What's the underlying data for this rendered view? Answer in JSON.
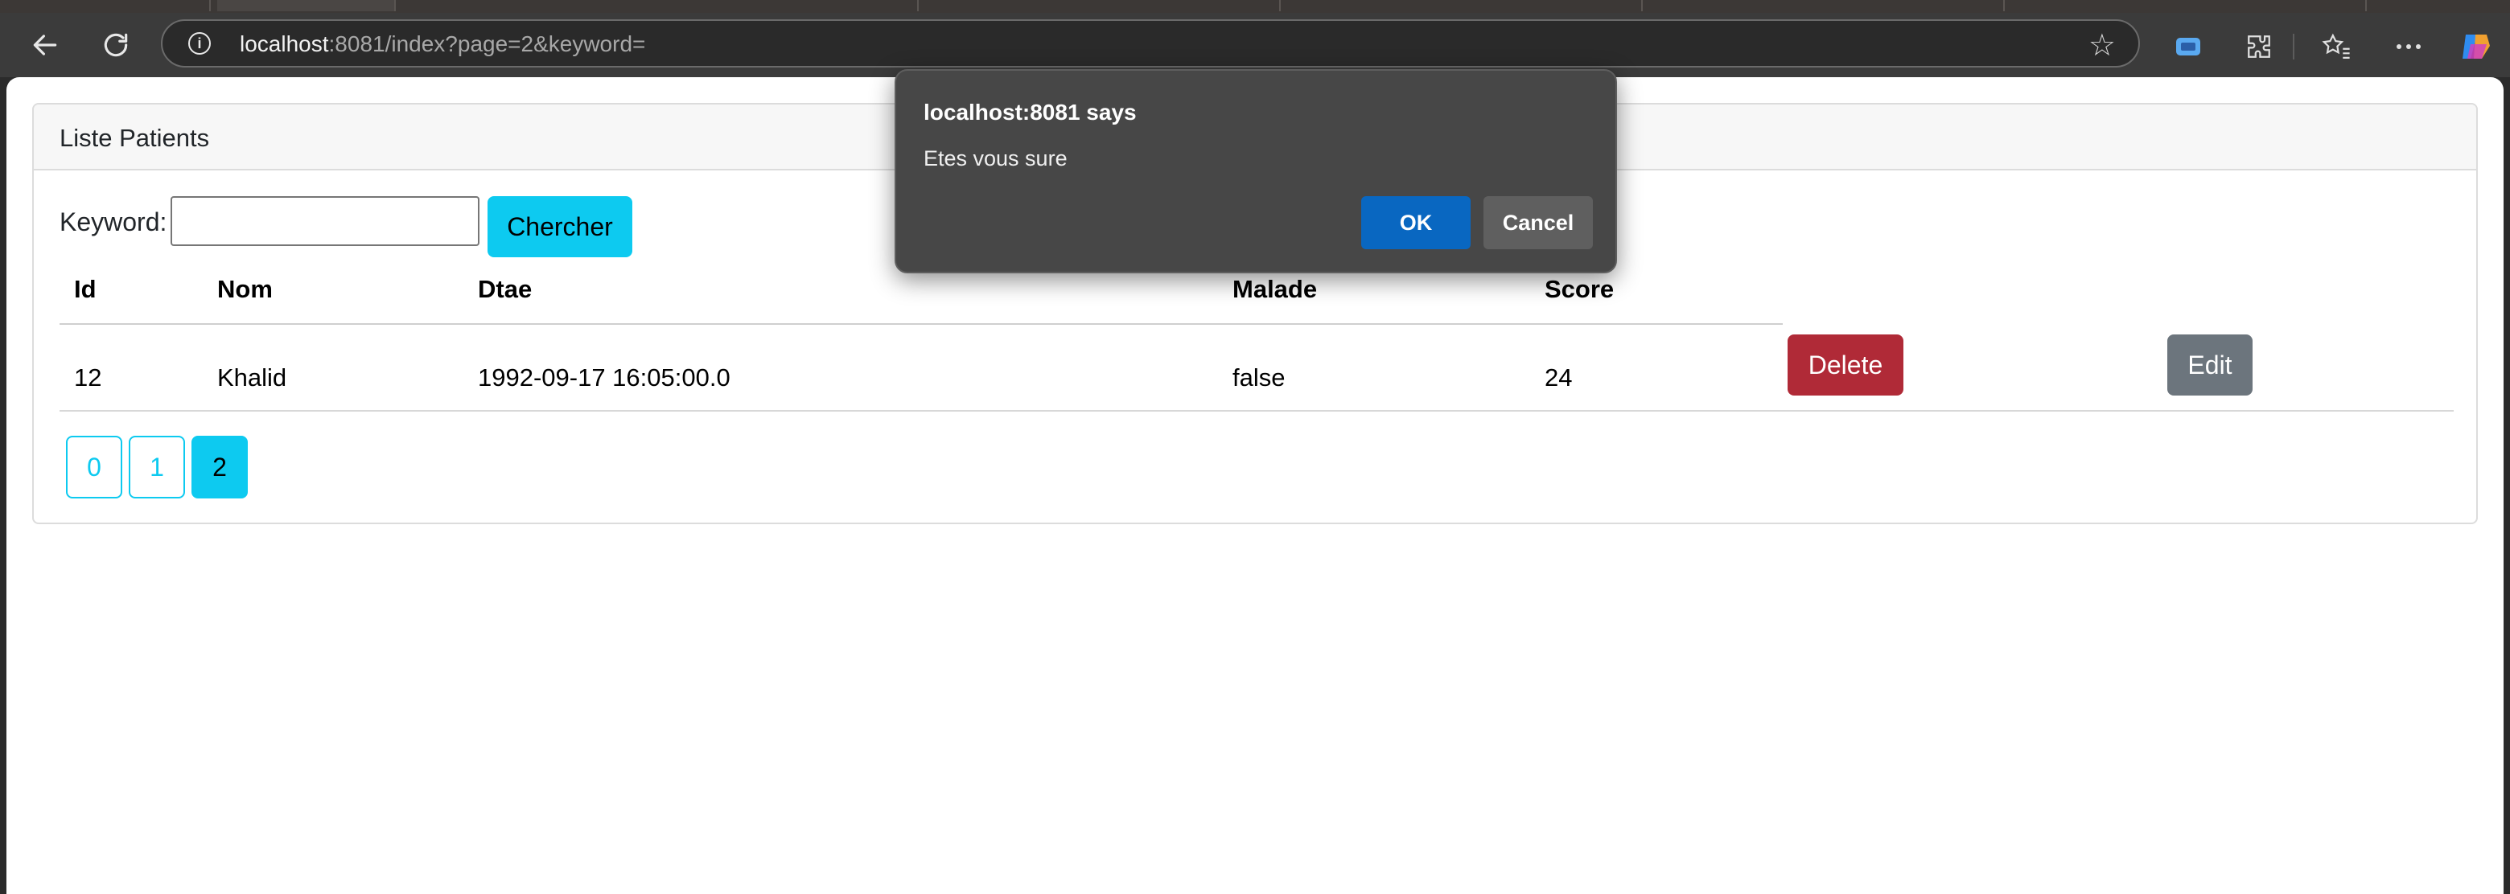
{
  "browser": {
    "url_host": "localhost",
    "url_rest": ":8081/index?page=2&keyword=",
    "icons": [
      "back-arrow-icon",
      "refresh-icon",
      "info-icon",
      "star-icon",
      "translate-icon",
      "extensions-icon",
      "favorites-icon",
      "more-icon",
      "copilot-icon"
    ]
  },
  "card": {
    "title": "Liste Patients"
  },
  "search": {
    "label": "Keyword:",
    "value": "",
    "button_label": "Chercher"
  },
  "table": {
    "headers": [
      "Id",
      "Nom",
      "Dtae",
      "Malade",
      "Score"
    ],
    "rows": [
      {
        "id": "12",
        "nom": "Khalid",
        "date": "1992-09-17 16:05:00.0",
        "malade": "false",
        "score": "24",
        "delete_label": "Delete",
        "edit_label": "Edit"
      }
    ]
  },
  "pagination": {
    "pages": [
      "0",
      "1",
      "2"
    ],
    "active": "2"
  },
  "dialog": {
    "title": "localhost:8081 says",
    "message": "Etes vous sure",
    "ok_label": "OK",
    "cancel_label": "Cancel"
  },
  "colors": {
    "info": "#0dcaf0",
    "danger": "#b02a37",
    "secondary": "#6c757d",
    "dialog_ok": "#0967c1"
  }
}
